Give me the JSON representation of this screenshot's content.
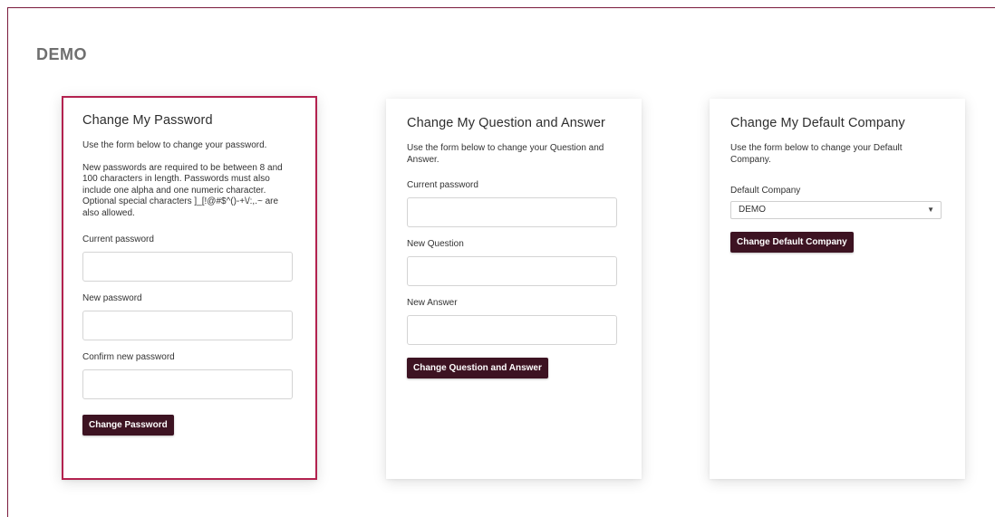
{
  "page": {
    "title": "DEMO"
  },
  "password_card": {
    "title": "Change My Password",
    "intro": "Use the form below to change your password.",
    "rules": "New passwords are required to be between 8 and 100 characters in length. Passwords must also include one alpha and one numeric character. Optional special characters ]_[!@#$^()-+\\/:,.~ are also allowed.",
    "current_label": "Current password",
    "new_label": "New password",
    "confirm_label": "Confirm new password",
    "submit_label": "Change Password"
  },
  "qa_card": {
    "title": "Change My Question and Answer",
    "intro": "Use the form below to change your Question and Answer.",
    "current_label": "Current password",
    "question_label": "New Question",
    "answer_label": "New Answer",
    "submit_label": "Change Question and Answer"
  },
  "company_card": {
    "title": "Change My Default Company",
    "intro": "Use the form below to change your Default Company.",
    "select_label": "Default Company",
    "select_value": "DEMO",
    "submit_label": "Change Default Company"
  },
  "colors": {
    "accent_border": "#b3224f",
    "button_bg": "#3d1322",
    "frame_border": "#7a1b3d"
  },
  "icons": {
    "select_arrow": "chevron-down-icon"
  }
}
